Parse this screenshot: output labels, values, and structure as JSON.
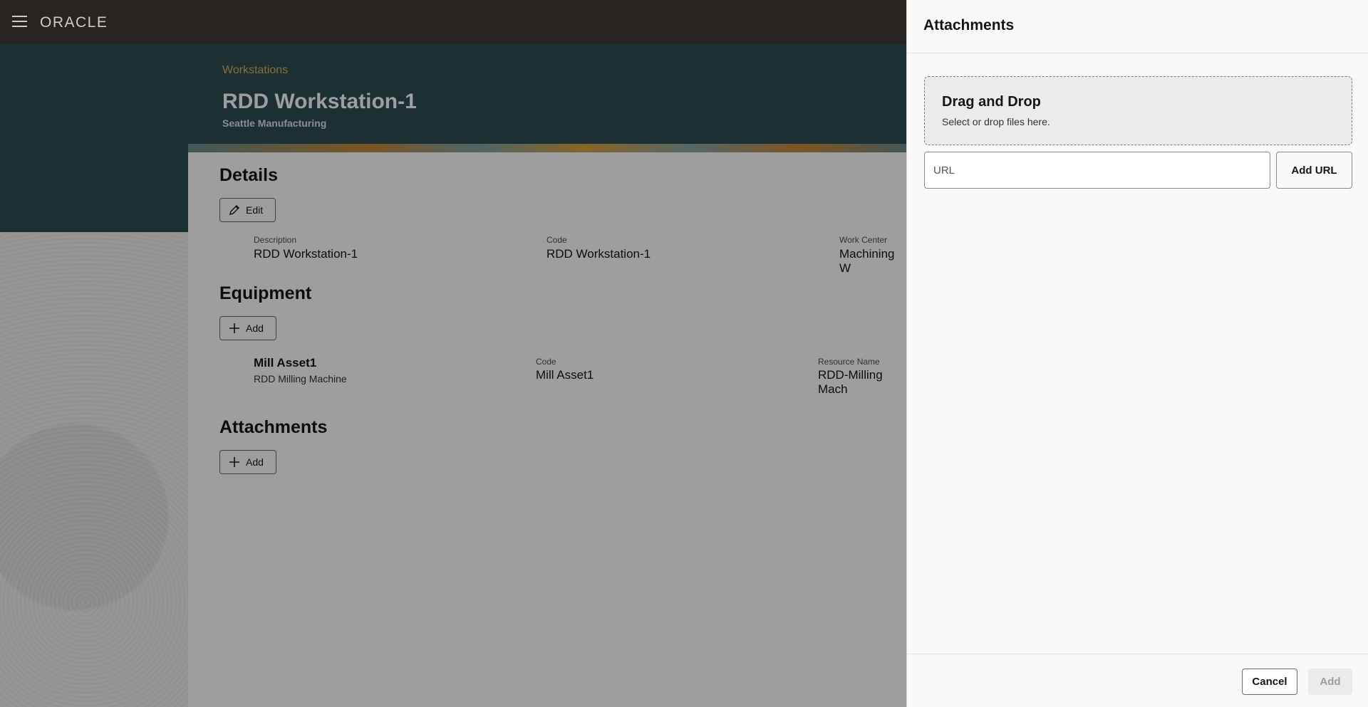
{
  "header": {
    "logo": "ORACLE",
    "menu_icon": "hamburger-menu-icon"
  },
  "hero": {
    "breadcrumb": "Workstations",
    "title": "RDD Workstation-1",
    "subtitle": "Seattle Manufacturing"
  },
  "details": {
    "heading": "Details",
    "edit_label": "Edit",
    "fields": [
      {
        "label": "Description",
        "value": "RDD Workstation-1"
      },
      {
        "label": "Code",
        "value": "RDD Workstation-1"
      },
      {
        "label": "Work Center",
        "value": "Machining W"
      }
    ]
  },
  "equipment": {
    "heading": "Equipment",
    "add_label": "Add",
    "item": {
      "name": "Mill Asset1",
      "description": "RDD Milling Machine",
      "code_label": "Code",
      "code_value": "Mill Asset1",
      "resource_label": "Resource Name",
      "resource_value": "RDD-Milling Mach"
    }
  },
  "attachments": {
    "heading": "Attachments",
    "add_label": "Add"
  },
  "drawer": {
    "title": "Attachments",
    "dropzone_title": "Drag and Drop",
    "dropzone_subtitle": "Select or drop files here.",
    "url_placeholder": "URL",
    "add_url_label": "Add URL",
    "cancel_label": "Cancel",
    "add_label": "Add"
  },
  "colors": {
    "topbar": "#312d2a",
    "hero": "#2e4e53",
    "breadcrumb": "#d4b36a",
    "drawer_bg": "#fbf9f8"
  }
}
